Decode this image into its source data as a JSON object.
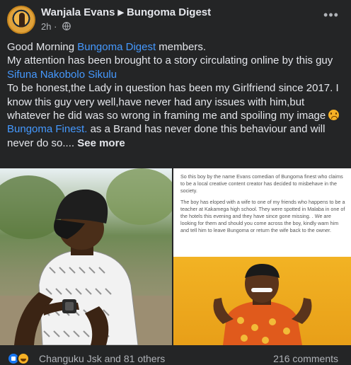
{
  "post": {
    "author": "Wanjala Evans",
    "group": "Bungoma Digest",
    "timestamp": "2h",
    "privacy_icon": "globe-icon",
    "more_icon": "more-options-icon",
    "text": {
      "line1_before": "Good Morning ",
      "line1_link": "Bungoma Digest",
      "line1_after": "  members.",
      "line2": "My attention has been brought to a story circulating online by this guy",
      "line3_link": "Sifuna Nakobolo Sikulu",
      "line4": "To be honest,the Lady in question has been my Girlfriend since 2017. I know this guy very well,have never had any issues with him,but whatever he did was so wrong in framing me and spoiling my image",
      "emoji": "disappointed-face-emoji",
      "line5_link": "Bungoma Finest.",
      "line5_after": "  as a Brand has never done this behaviour and will never do so.... ",
      "see_more": "See more"
    },
    "photos": {
      "right_notice": {
        "para1": "So this boy by the name Evans comedian of Bungoma  finest who claims to be a local creative content creator has decided to misbehave in the society.",
        "para2": "The boy has eloped with a wife to one of my friends who happens to be a teacher at Kakamega high school. They were spotted in Malaba in one of the hotels this evening and they have since gone missing. . We are looking for them and should you come across the boy,  kindly warn him and tell him to leave Bungoma or return the wife back to the owner."
      }
    },
    "reactions": {
      "icons": [
        "like-icon",
        "haha-icon"
      ],
      "summary": "Changuku Jsk and 81 others",
      "comments": "216 comments"
    }
  },
  "colors": {
    "background": "#242526",
    "text": "#e4e6eb",
    "secondary_text": "#b0b3b8",
    "link": "#4599ff"
  }
}
